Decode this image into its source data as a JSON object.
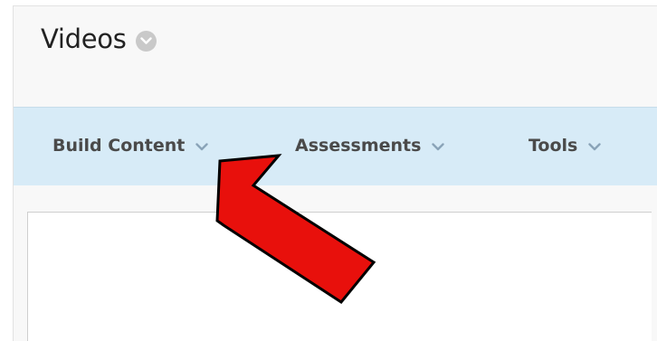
{
  "page": {
    "title": "Videos",
    "title_menu_icon": "chevron-down-circle-icon"
  },
  "action_bar": {
    "items": [
      {
        "label": "Build Content",
        "icon": "chevron-down-icon"
      },
      {
        "label": "Assessments",
        "icon": "chevron-down-icon"
      },
      {
        "label": "Tools",
        "icon": "chevron-down-icon"
      }
    ]
  },
  "annotation": {
    "type": "arrow",
    "color": "#e8100c",
    "outline": "#000000",
    "points_to": "Build Content"
  },
  "colors": {
    "action_bar_bg": "#d7ebf7",
    "page_bg": "#f8f8f8",
    "label_text": "#4a4a4a",
    "chevron": "#8aa3b8"
  }
}
